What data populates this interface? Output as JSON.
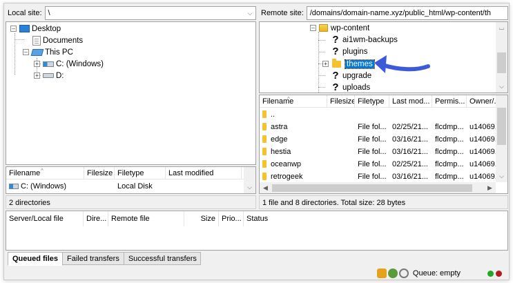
{
  "local": {
    "site_label": "Local site:",
    "site_path": "\\",
    "tree": [
      {
        "label": "Desktop",
        "icon": "desktop-icon"
      },
      {
        "label": "Documents",
        "icon": "document-icon"
      },
      {
        "label": "This PC",
        "icon": "computer-icon"
      },
      {
        "label": "C: (Windows)",
        "icon": "windows-drive-icon"
      },
      {
        "label": "D:",
        "icon": "drive-icon"
      }
    ],
    "columns": [
      "Filename",
      "Filesize",
      "Filetype",
      "Last modified"
    ],
    "files": [
      {
        "name": "C: (Windows)",
        "size": "",
        "type": "Local Disk",
        "modified": ""
      }
    ],
    "status": "2 directories"
  },
  "remote": {
    "site_label": "Remote site:",
    "site_path": "/domains/domain-name.xyz/public_html/wp-content/th",
    "tree": [
      {
        "label": "wp-content",
        "icon": "folder-open-icon"
      },
      {
        "label": "ai1wm-backups",
        "icon": "unknown-folder-icon"
      },
      {
        "label": "plugins",
        "icon": "unknown-folder-icon"
      },
      {
        "label": "themes",
        "icon": "folder-icon",
        "selected": true
      },
      {
        "label": "upgrade",
        "icon": "unknown-folder-icon"
      },
      {
        "label": "uploads",
        "icon": "unknown-folder-icon"
      }
    ],
    "columns": [
      "Filename",
      "Filesize",
      "Filetype",
      "Last mod...",
      "Permis...",
      "Owner/..."
    ],
    "files": [
      {
        "name": "..",
        "type": "",
        "modified": "",
        "perms": "",
        "owner": ""
      },
      {
        "name": "astra",
        "type": "File fol...",
        "modified": "02/25/21...",
        "perms": "flcdmp...",
        "owner": "u14069..."
      },
      {
        "name": "edge",
        "type": "File fol...",
        "modified": "03/16/21...",
        "perms": "flcdmp...",
        "owner": "u14069..."
      },
      {
        "name": "hestia",
        "type": "File fol...",
        "modified": "03/16/21...",
        "perms": "flcdmp...",
        "owner": "u14069..."
      },
      {
        "name": "oceanwp",
        "type": "File fol...",
        "modified": "02/25/21...",
        "perms": "flcdmp...",
        "owner": "u14069..."
      },
      {
        "name": "retrogeek",
        "type": "File fol...",
        "modified": "03/16/21...",
        "perms": "flcdmp...",
        "owner": "u14069..."
      }
    ],
    "status": "1 file and 8 directories. Total size: 28 bytes"
  },
  "queue": {
    "columns": [
      "Server/Local file",
      "Dire...",
      "Remote file",
      "Size",
      "Prio...",
      "Status"
    ],
    "tabs": [
      "Queued files",
      "Failed transfers",
      "Successful transfers"
    ],
    "status": "Queue: empty"
  },
  "annotation": {
    "color": "#3b5bdb"
  },
  "colors": {
    "selection": "#0078d7",
    "folder": "#f5c12e",
    "led_green": "#22a822",
    "led_red": "#b51c1c"
  }
}
